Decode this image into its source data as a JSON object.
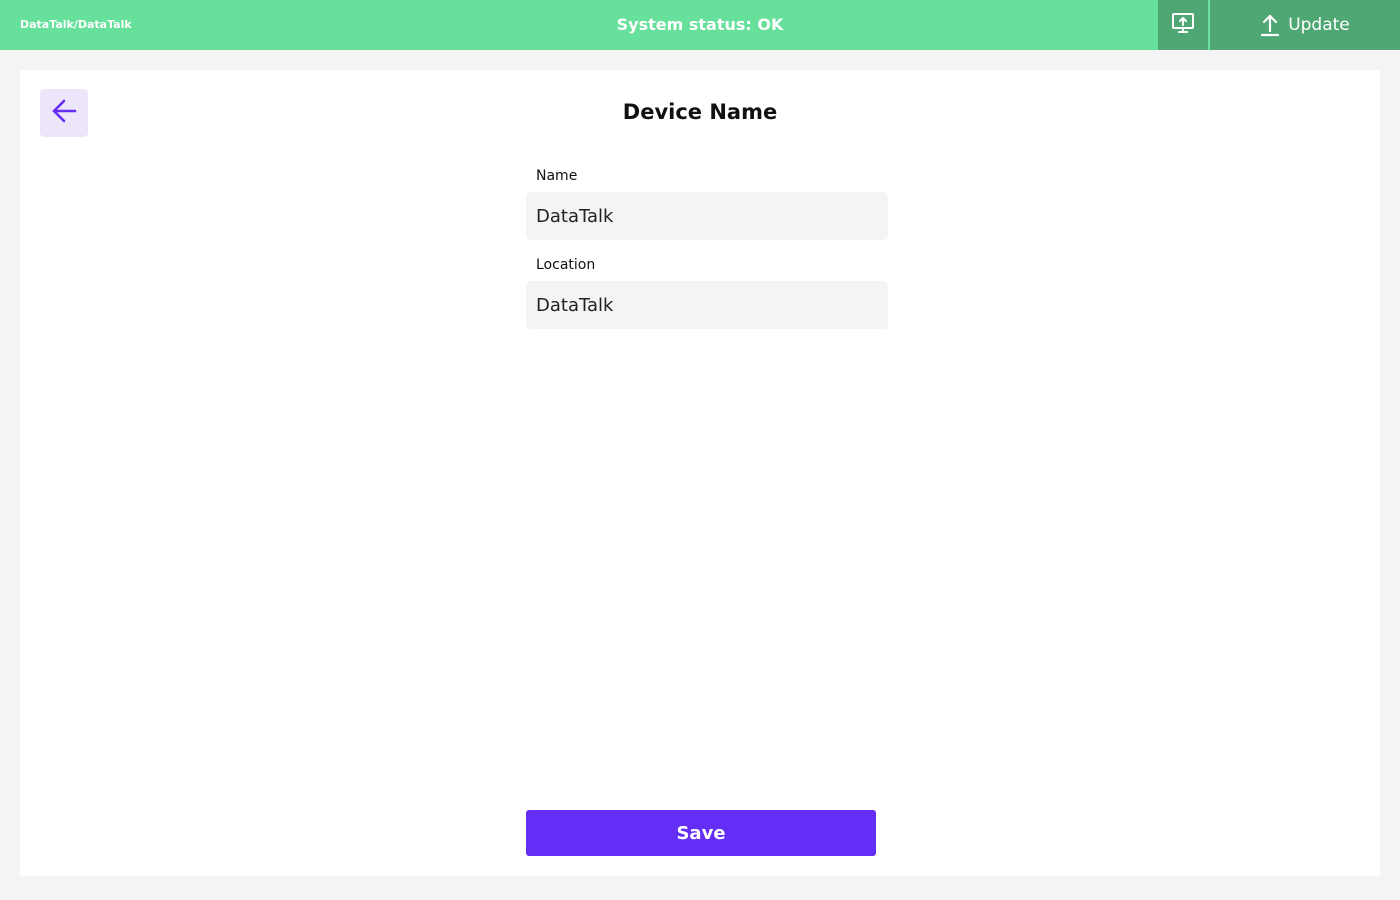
{
  "header": {
    "breadcrumb": "DataTalk/DataTalk",
    "system_status": "System status: OK",
    "screen_upload_icon": "monitor-upload-icon",
    "update_label": "Update",
    "update_icon": "upload-arrow-icon"
  },
  "page": {
    "back_icon": "arrow-left-icon",
    "title": "Device Name"
  },
  "form": {
    "name_label": "Name",
    "name_value": "DataTalk",
    "location_label": "Location",
    "location_value": "DataTalk",
    "save_label": "Save"
  },
  "colors": {
    "header_bg": "#66e09b",
    "header_button_bg": "#4fa874",
    "accent": "#652ef6",
    "back_button_bg": "#ede6fb",
    "page_bg": "#f4f4f4",
    "input_bg": "#f4f4f4"
  }
}
